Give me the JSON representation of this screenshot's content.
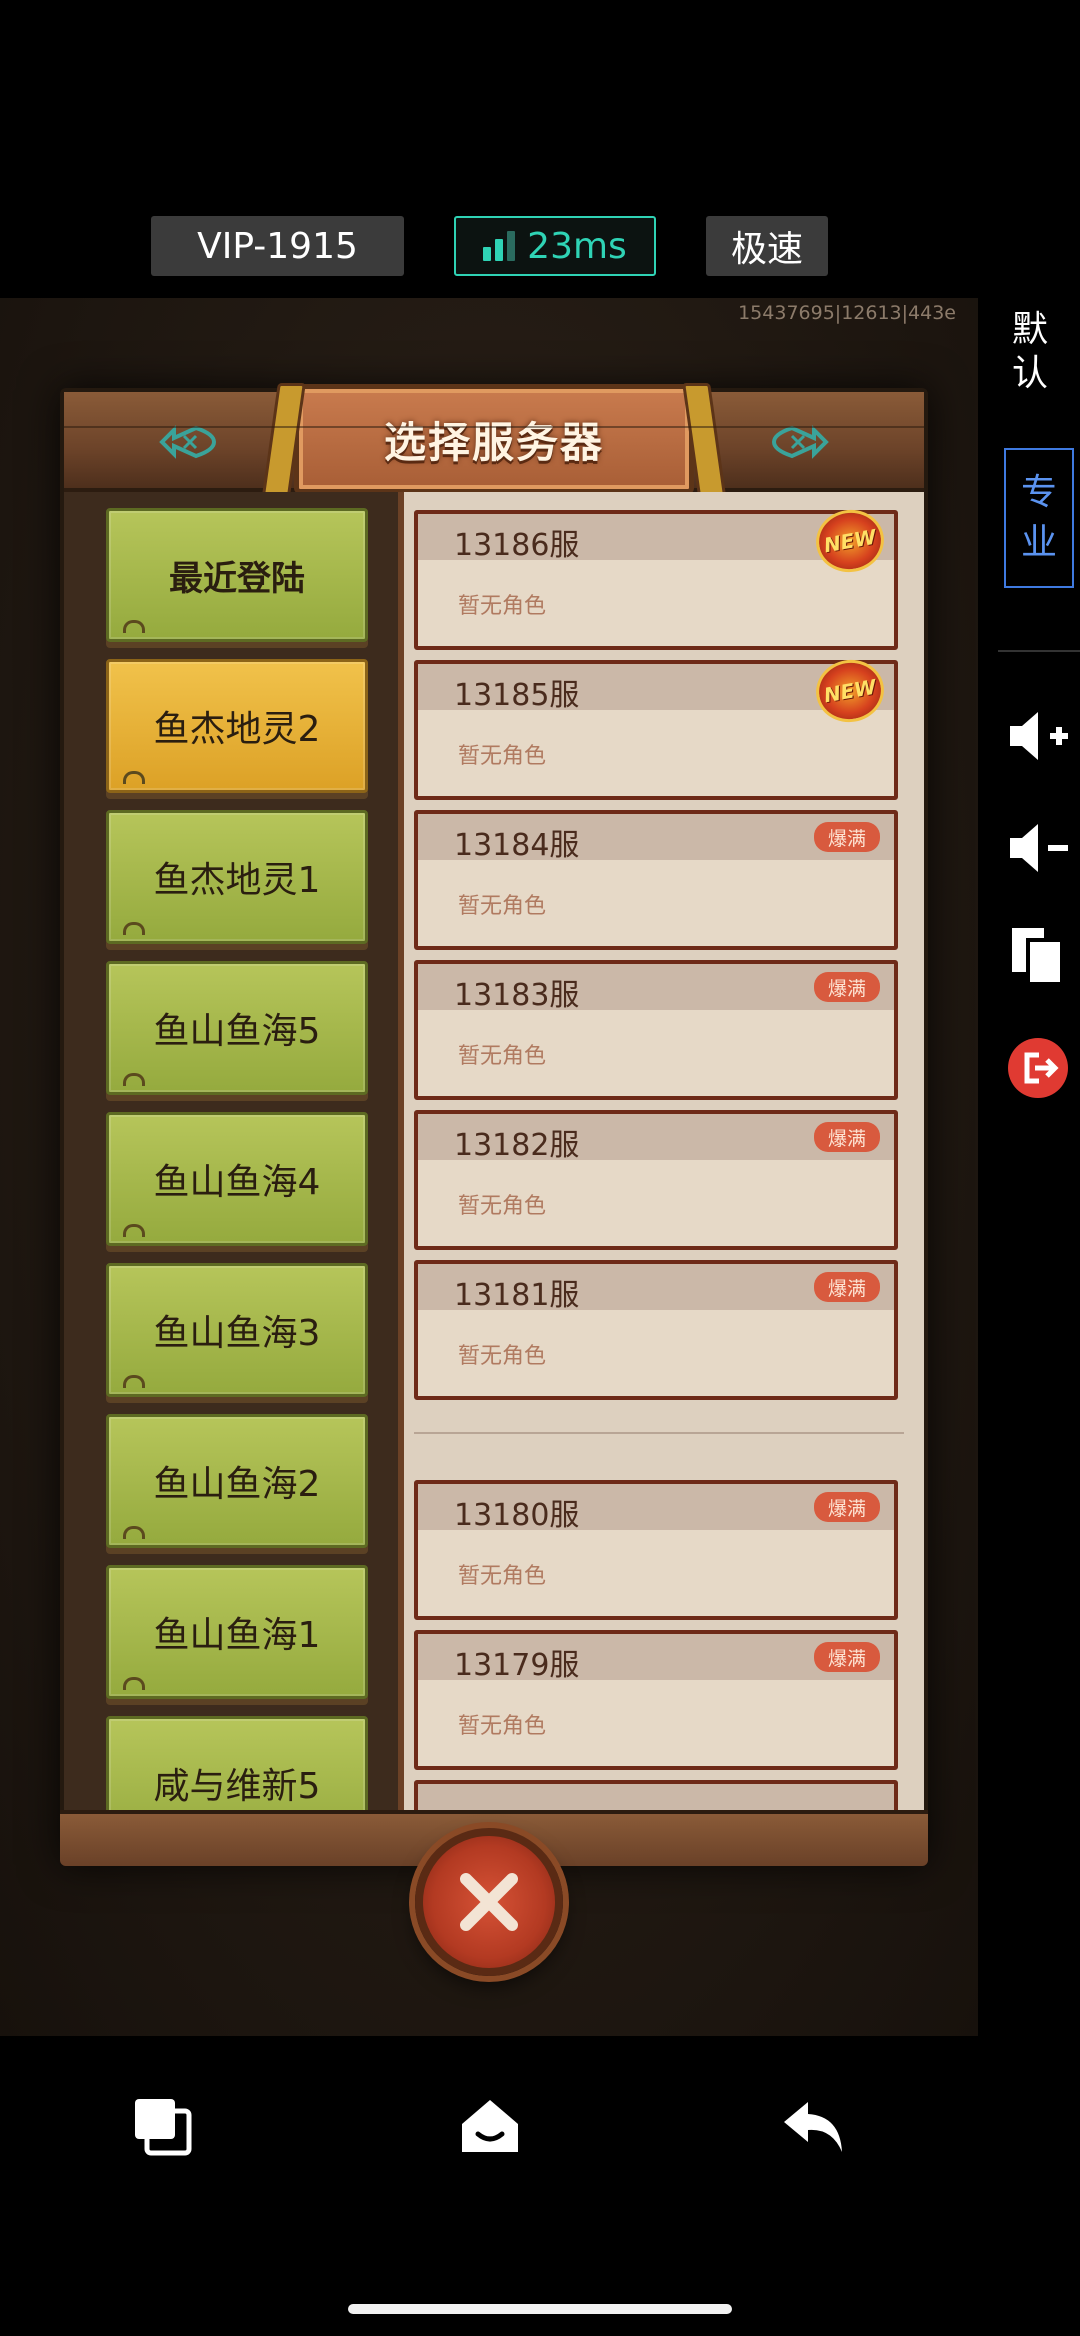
{
  "status": {
    "vip_label": "VIP-1915",
    "ping_label": "23ms",
    "speed_label": "极速"
  },
  "game": {
    "build_id": "15437695|12613|443e",
    "title": "选择服务器",
    "categories": [
      {
        "label": "最近登陆",
        "state": "normal",
        "bold": true
      },
      {
        "label": "鱼杰地灵2",
        "state": "selected"
      },
      {
        "label": "鱼杰地灵1",
        "state": "normal"
      },
      {
        "label": "鱼山鱼海5",
        "state": "normal"
      },
      {
        "label": "鱼山鱼海4",
        "state": "normal"
      },
      {
        "label": "鱼山鱼海3",
        "state": "normal"
      },
      {
        "label": "鱼山鱼海2",
        "state": "normal"
      },
      {
        "label": "鱼山鱼海1",
        "state": "normal"
      },
      {
        "label": "咸与维新5",
        "state": "normal"
      }
    ],
    "servers": [
      {
        "name": "13186服",
        "role": "暂无角色",
        "badge": "NEW"
      },
      {
        "name": "13185服",
        "role": "暂无角色",
        "badge": "NEW"
      },
      {
        "name": "13184服",
        "role": "暂无角色",
        "badge": "爆满"
      },
      {
        "name": "13183服",
        "role": "暂无角色",
        "badge": "爆满"
      },
      {
        "name": "13182服",
        "role": "暂无角色",
        "badge": "爆满"
      },
      {
        "name": "13181服",
        "role": "暂无角色",
        "badge": "爆满"
      },
      {
        "name": "13180服",
        "role": "暂无角色",
        "badge": "爆满"
      },
      {
        "name": "13179服",
        "role": "暂无角色",
        "badge": "爆满"
      }
    ]
  },
  "side": {
    "mode_default": "默认",
    "mode_pro": "专业",
    "icons": [
      "volume-up-icon",
      "volume-down-icon",
      "copy-icon",
      "exit-icon"
    ]
  },
  "nav": {
    "icons": [
      "recent-apps-icon",
      "home-icon",
      "back-icon"
    ]
  },
  "colors": {
    "accent_teal": "#2fd3b5",
    "accent_blue": "#3f7ae0",
    "category_green": "#a6b84a",
    "category_selected": "#e8b336",
    "exit_red": "#e03a32"
  }
}
